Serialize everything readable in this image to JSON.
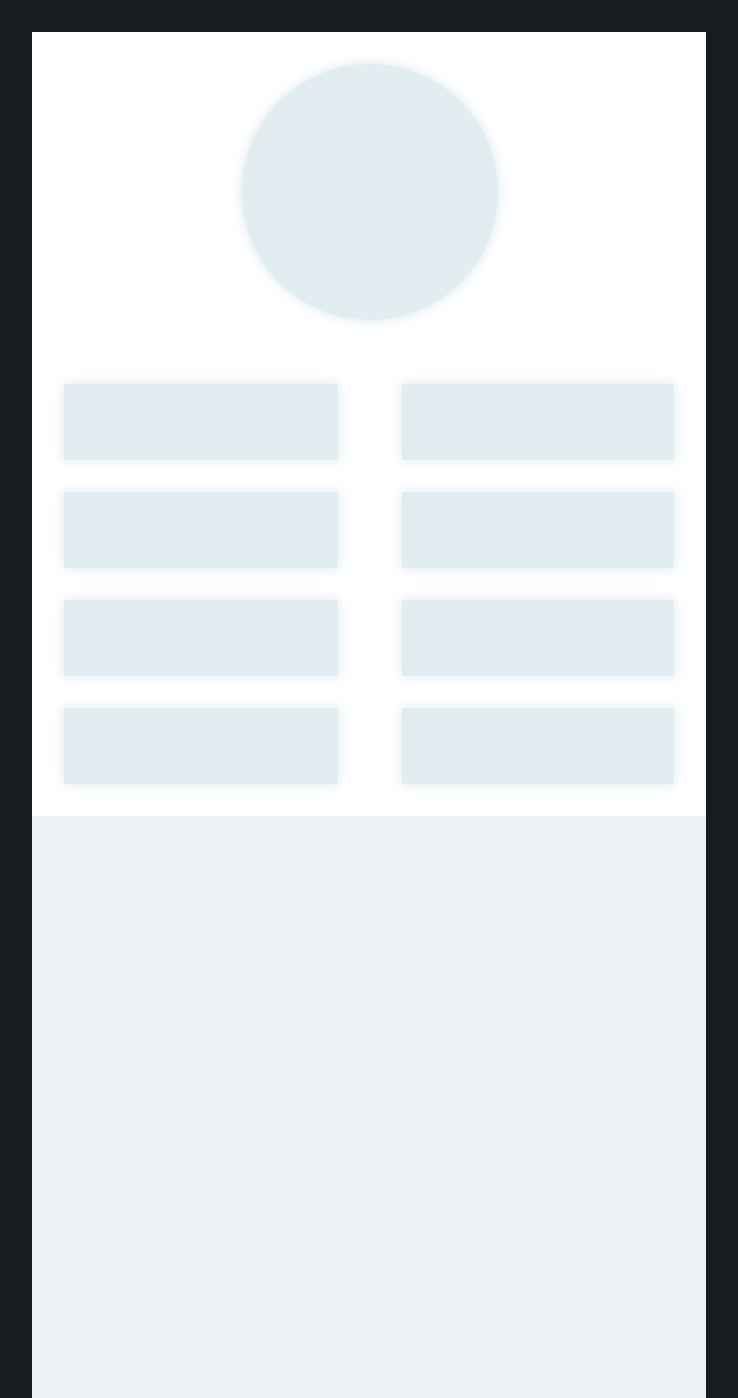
{
  "skeleton": {
    "state": "loading",
    "tile_count": 8
  },
  "colors": {
    "background": "#161c20",
    "panel": "#ffffff",
    "placeholder": "#e1edf1",
    "lower_panel": "#ecf2f5"
  }
}
